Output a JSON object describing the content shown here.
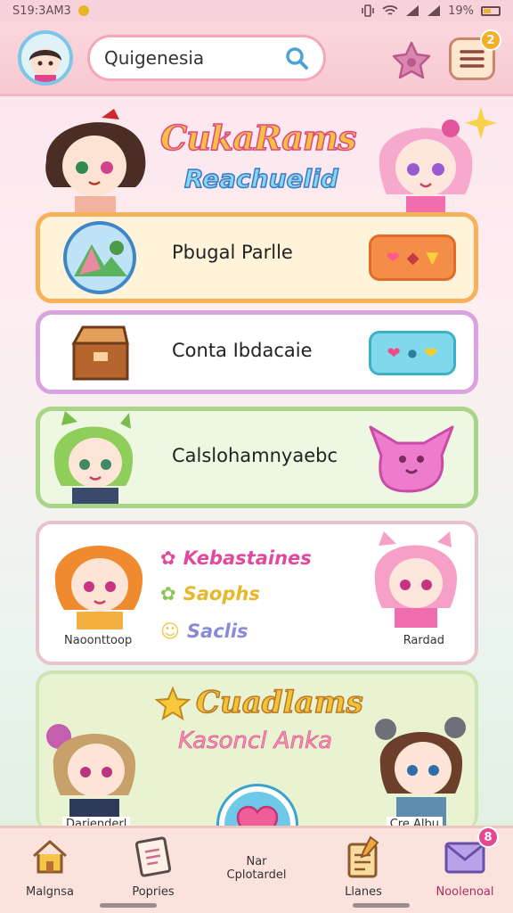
{
  "status_bar": {
    "time": "S19:3AM3",
    "battery": "19%"
  },
  "header": {
    "search_value": "Quigenesia",
    "menu_badge": "2"
  },
  "hero": {
    "title": "CukaRams",
    "subtitle": "Reachuelid"
  },
  "cards": [
    {
      "label": "Pbugal Parlle"
    },
    {
      "label": "Conta Ibdacaie"
    },
    {
      "label": "Calslohamnyaebc"
    }
  ],
  "card4": {
    "rows": [
      "Kebastaines",
      "Saophs",
      "Saclis"
    ],
    "left_character_label": "Naoonttoop",
    "right_character_label": "Rardad"
  },
  "card5": {
    "title": "Cuadlams",
    "subtitle": "Kasoncl Anka",
    "left_character_label": "Darienderl",
    "right_character_label": "Cre Albu"
  },
  "bottom_nav": {
    "items": [
      {
        "label": "Malgnsa"
      },
      {
        "label": "Popries"
      },
      {
        "label": "Nar\nCplotardel"
      },
      {
        "label": "Llanes"
      },
      {
        "label": "Noolenoal",
        "badge": "8"
      }
    ]
  },
  "colors": {
    "accent_pink": "#e0448a",
    "accent_blue": "#3ab0c9",
    "nav_active": "#b02b64"
  }
}
